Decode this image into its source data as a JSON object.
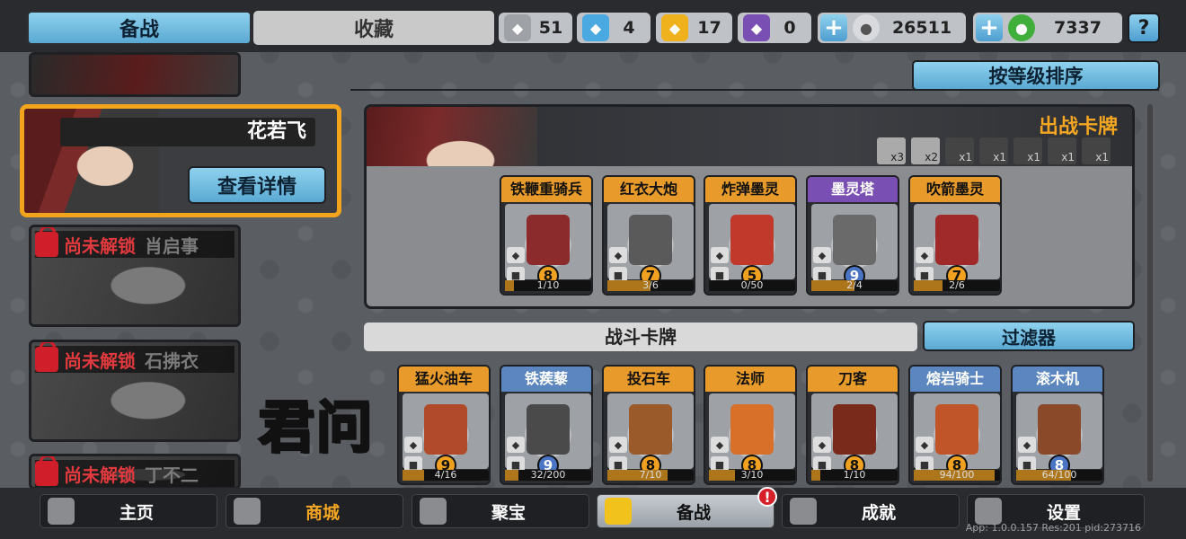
{
  "tabs": {
    "active": "备战",
    "inactive": "收藏"
  },
  "resources": [
    {
      "icon": "silver-crest-icon",
      "value": "51",
      "color": "#bfc2c6"
    },
    {
      "icon": "blue-crystal-icon",
      "value": "4",
      "color": "#4aa9e0"
    },
    {
      "icon": "gold-badge-icon",
      "value": "17",
      "color": "#f0b21c"
    },
    {
      "icon": "purple-gem-icon",
      "value": "0",
      "color": "#7a4fb3"
    }
  ],
  "currency": {
    "silver_coin": "26511",
    "green_coin": "7337",
    "plus_symbol": "+",
    "help_symbol": "?"
  },
  "heroes": [
    {
      "name": "",
      "locked": false,
      "lock_text": ""
    },
    {
      "name": "花若飞",
      "locked": false,
      "detail_label": "查看详情"
    },
    {
      "name": "肖启事",
      "locked": true,
      "lock_text": "尚未解锁"
    },
    {
      "name": "石拂衣",
      "locked": true,
      "lock_text": "尚未解锁"
    },
    {
      "name": "丁不二",
      "locked": true,
      "lock_text": "尚未解锁"
    }
  ],
  "brand": "君问",
  "sort_label": "按等级排序",
  "deck": {
    "title": "出战卡牌",
    "type_counts": [
      "x3",
      "x2",
      "x1",
      "x1",
      "x1",
      "x1",
      "x1"
    ],
    "cards": [
      {
        "name": "铁鞭重骑兵",
        "level": "8",
        "progress": "1/10",
        "fill": 0.1,
        "cap": "orange",
        "color": "#8b2b2b"
      },
      {
        "name": "红衣大炮",
        "level": "7",
        "progress": "3/6",
        "fill": 0.5,
        "cap": "orange",
        "color": "#5a5a5a"
      },
      {
        "name": "炸弹墨灵",
        "level": "5",
        "progress": "0/50",
        "fill": 0,
        "cap": "orange",
        "color": "#c0392b"
      },
      {
        "name": "墨灵塔",
        "level": "9",
        "progress": "2/4",
        "fill": 0.5,
        "cap": "purple",
        "color": "#6a6a6a"
      },
      {
        "name": "吹箭墨灵",
        "level": "7",
        "progress": "2/6",
        "fill": 0.33,
        "cap": "orange",
        "color": "#a02a2a"
      }
    ]
  },
  "battle": {
    "title": "战斗卡牌",
    "filter_label": "过滤器",
    "cards": [
      {
        "name": "猛火油车",
        "level": "9",
        "progress": "4/16",
        "fill": 0.25,
        "cap": "orange",
        "lvl": "orange",
        "color": "#b04a2a"
      },
      {
        "name": "铁蒺藜",
        "level": "9",
        "progress": "32/200",
        "fill": 0.16,
        "cap": "blue",
        "lvl": "blue",
        "color": "#4a4a4a"
      },
      {
        "name": "投石车",
        "level": "8",
        "progress": "7/10",
        "fill": 0.7,
        "cap": "orange",
        "lvl": "orange",
        "color": "#9b5a2a"
      },
      {
        "name": "法师",
        "level": "8",
        "progress": "3/10",
        "fill": 0.3,
        "cap": "orange",
        "lvl": "orange",
        "color": "#d9702a"
      },
      {
        "name": "刀客",
        "level": "8",
        "progress": "1/10",
        "fill": 0.1,
        "cap": "orange",
        "lvl": "orange",
        "color": "#7a2a1a"
      },
      {
        "name": "熔岩骑士",
        "level": "8",
        "progress": "94/100",
        "fill": 0.94,
        "cap": "blue",
        "lvl": "orange",
        "color": "#c0552a"
      },
      {
        "name": "滚木机",
        "level": "8",
        "progress": "64/100",
        "fill": 0.64,
        "cap": "blue",
        "lvl": "blue",
        "color": "#8a4a2a"
      }
    ]
  },
  "nav": [
    {
      "label": "主页",
      "icon": "castle-icon"
    },
    {
      "label": "商城",
      "icon": "coins-icon"
    },
    {
      "label": "聚宝",
      "icon": "treasure-bowl-icon"
    },
    {
      "label": "备战",
      "icon": "cards-icon",
      "active": true,
      "alert": "!"
    },
    {
      "label": "成就",
      "icon": "achievement-grid-icon"
    },
    {
      "label": "设置",
      "icon": "gear-icon"
    }
  ],
  "version": "App: 1.0.0.157 Res:201 pid:273716"
}
